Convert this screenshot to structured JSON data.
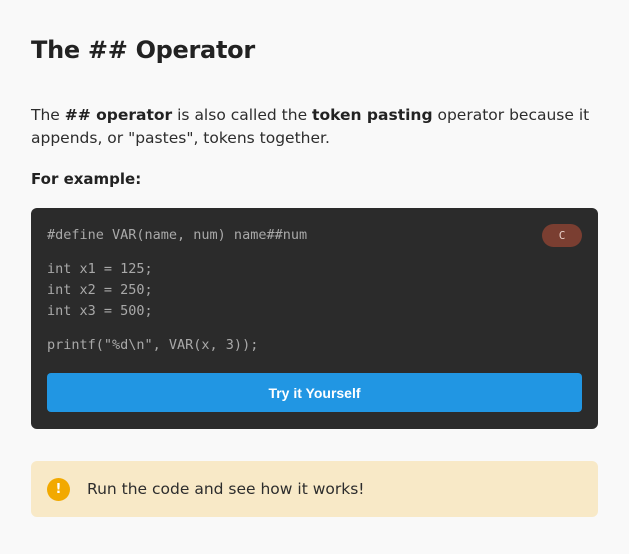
{
  "page": {
    "title": "The ## Operator"
  },
  "intro": {
    "part1": "The ",
    "bold1": "## operator",
    "part2": " is also called the ",
    "bold2": "token pasting",
    "part3": " operator because it appends, or \"pastes\", tokens together."
  },
  "example": {
    "label": "For example:"
  },
  "code_block": {
    "language": "C",
    "lines": [
      "#define VAR(name, num) name##num",
      "",
      "int x1 = 125;",
      "int x2 = 250;",
      "int x3 = 500;",
      "",
      "printf(\"%d\\n\", VAR(x, 3));"
    ],
    "button_label": "Try it Yourself"
  },
  "note": {
    "icon": "exclamation-icon",
    "icon_glyph": "!",
    "text": "Run the code and see how it works!"
  },
  "colors": {
    "code_bg": "#2b2b2b",
    "button": "#2196e3",
    "badge": "#7a3e31",
    "note_bg": "#f8e9c7",
    "note_icon": "#f2a900"
  }
}
